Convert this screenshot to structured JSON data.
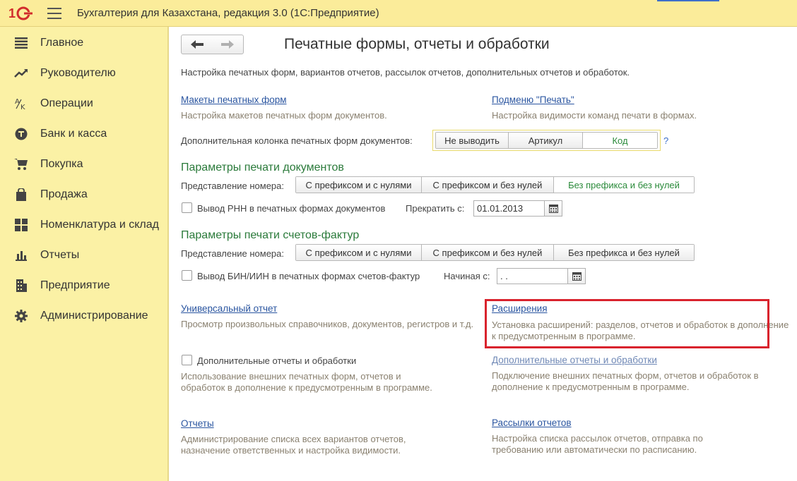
{
  "app": {
    "title": "Бухгалтерия для Казахстана, редакция 3.0  (1С:Предприятие)",
    "logo_text": "1С"
  },
  "sidebar": {
    "items": [
      {
        "label": "Главное",
        "icon": "list-icon"
      },
      {
        "label": "Руководителю",
        "icon": "trend-icon"
      },
      {
        "label": "Операции",
        "icon": "operations-icon"
      },
      {
        "label": "Банк и касса",
        "icon": "coin-icon"
      },
      {
        "label": "Покупка",
        "icon": "cart-icon"
      },
      {
        "label": "Продажа",
        "icon": "bag-icon"
      },
      {
        "label": "Номенклатура и склад",
        "icon": "grid-icon"
      },
      {
        "label": "Отчеты",
        "icon": "bar-chart-icon"
      },
      {
        "label": "Предприятие",
        "icon": "building-icon"
      },
      {
        "label": "Администрирование",
        "icon": "gear-icon"
      }
    ]
  },
  "main": {
    "title": "Печатные формы, отчеты и обработки",
    "intro": "Настройка печатных форм, вариантов отчетов, рассылок отчетов, дополнительных отчетов и обработок.",
    "print_layouts": {
      "link": "Макеты печатных форм",
      "desc": "Настройка макетов печатных форм документов."
    },
    "print_submenu": {
      "link": "Подменю \"Печать\"",
      "desc": "Настройка видимости команд печати в формах."
    },
    "extra_column": {
      "label": "Дополнительная колонка печатных форм документов:",
      "options": [
        "Не выводить",
        "Артикул",
        "Код"
      ],
      "selected": "Код",
      "help": "?"
    },
    "doc_print": {
      "section": "Параметры печати документов",
      "number_label": "Представление номера:",
      "options": [
        "С префиксом и с нулями",
        "С префиксом и без нулей",
        "Без префикса и без нулей"
      ],
      "selected": "Без префикса и без нулей",
      "rnn_label": "Вывод РНН в печатных формах документов",
      "stop_label": "Прекратить с:",
      "stop_date": "01.01.2013"
    },
    "invoice_print": {
      "section": "Параметры печати счетов-фактур",
      "number_label": "Представление номера:",
      "options": [
        "С префиксом и с нулями",
        "С префиксом и без нулей",
        "Без префикса и без нулей"
      ],
      "bin_label": "Вывод БИН/ИИН в печатных формах счетов-фактур",
      "start_label": "Начиная с:",
      "start_date": " .  ."
    },
    "universal_report": {
      "link": "Универсальный отчет",
      "desc": "Просмотр произвольных справочников, документов, регистров и т.д."
    },
    "extensions": {
      "link": "Расширения",
      "desc": "Установка расширений: разделов, отчетов и обработок в дополнение к предусмотренным в программе."
    },
    "additional_reports": {
      "checkbox_label": "Дополнительные отчеты и обработки",
      "desc": "Использование внешних печатных форм, отчетов и обработок в дополнение к предусмотренным в программе."
    },
    "additional_reports_link": {
      "link": "Дополнительные отчеты и обработки",
      "desc": "Подключение внешних печатных форм, отчетов и обработок в дополнение к предусмотренным в программе."
    },
    "reports": {
      "link": "Отчеты",
      "desc": "Администрирование списка всех вариантов отчетов, назначение ответственных и настройка видимости."
    },
    "mailing": {
      "link": "Рассылки отчетов",
      "desc": "Настройка списка рассылок отчетов, отправка по требованию или автоматически по расписанию."
    }
  },
  "colors": {
    "topbar": "#fbec9a",
    "sidebar": "#fbf1a5",
    "link": "#2a55a0",
    "section": "#2a7a3a",
    "highlight": "#d9232d"
  }
}
